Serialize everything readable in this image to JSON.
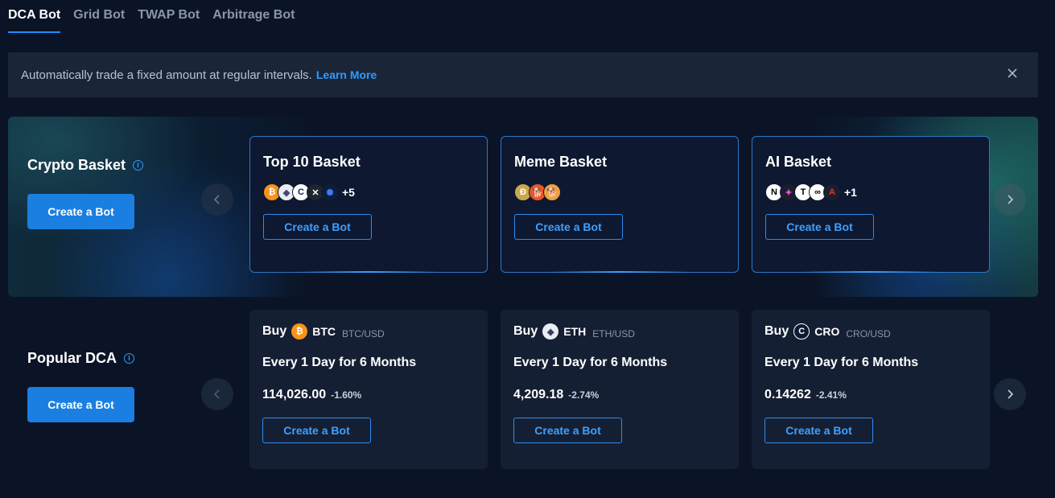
{
  "tabs": [
    {
      "label": "DCA Bot",
      "active": true
    },
    {
      "label": "Grid Bot",
      "active": false
    },
    {
      "label": "TWAP Bot",
      "active": false
    },
    {
      "label": "Arbitrage Bot",
      "active": false
    }
  ],
  "banner": {
    "text": "Automatically trade a fixed amount at regular intervals.",
    "link": "Learn More",
    "close_icon": "close-icon"
  },
  "crypto_basket": {
    "title": "Crypto Basket",
    "create_label": "Create a Bot",
    "cards": [
      {
        "name": "Top 10 Basket",
        "coins": [
          "btc",
          "eth",
          "cro",
          "xrp",
          "cardano"
        ],
        "more": "+5",
        "create_label": "Create a Bot"
      },
      {
        "name": "Meme Basket",
        "coins": [
          "doge",
          "shib",
          "shib2"
        ],
        "more": "",
        "create_label": "Create a Bot"
      },
      {
        "name": "AI Basket",
        "coins": [
          "near",
          "fet",
          "tao",
          "render",
          "arkm"
        ],
        "more": "+1",
        "create_label": "Create a Bot"
      }
    ]
  },
  "popular_dca": {
    "title": "Popular DCA",
    "create_label": "Create a Bot",
    "cards": [
      {
        "buy": "Buy",
        "symbol": "BTC",
        "pair": "BTC/USD",
        "frequency": "Every 1 Day for 6 Months",
        "price": "114,026.00",
        "change": "-1.60%",
        "create_label": "Create a Bot",
        "icon": "bitcoin-icon"
      },
      {
        "buy": "Buy",
        "symbol": "ETH",
        "pair": "ETH/USD",
        "frequency": "Every 1 Day for 6 Months",
        "price": "4,209.18",
        "change": "-2.74%",
        "create_label": "Create a Bot",
        "icon": "ethereum-icon"
      },
      {
        "buy": "Buy",
        "symbol": "CRO",
        "pair": "CRO/USD",
        "frequency": "Every 1 Day for 6 Months",
        "price": "0.14262",
        "change": "-2.41%",
        "create_label": "Create a Bot",
        "icon": "cronos-icon"
      }
    ]
  },
  "colors": {
    "background": "#0b1426",
    "accent": "#1a7fe0",
    "link": "#2e9bff",
    "card_border": "#2a78c8"
  }
}
